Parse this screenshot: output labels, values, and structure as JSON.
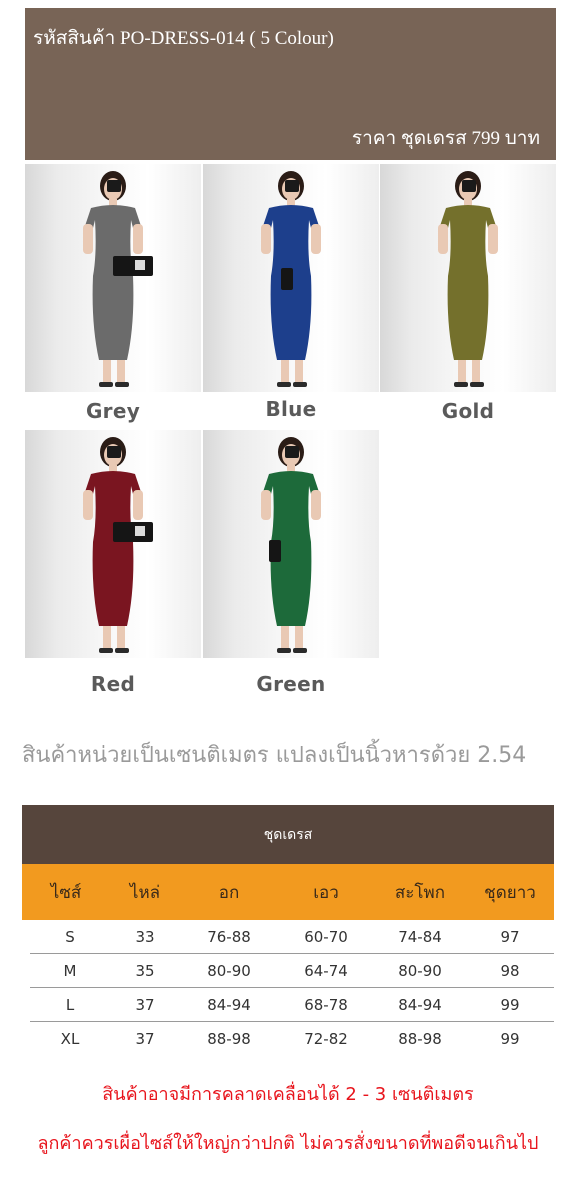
{
  "header": {
    "product_code": "รหัสสินค้า PO-DRESS-014 ( 5 Colour)",
    "price": "ราคา ชุดเดรส 799 บาท"
  },
  "colors": [
    {
      "name": "Grey",
      "dress_color": "#6b6b6b"
    },
    {
      "name": "Blue",
      "dress_color": "#1d3f8c"
    },
    {
      "name": "Gold",
      "dress_color": "#74702c"
    },
    {
      "name": "Red",
      "dress_color": "#7a1520"
    },
    {
      "name": "Green",
      "dress_color": "#1d6a3a"
    }
  ],
  "unit_note": "สินค้าหน่วยเป็นเซนติเมตร แปลงเป็นนิ้วหารด้วย 2.54",
  "size_table": {
    "title": "ชุดเดรส",
    "headers": [
      "ไซส์",
      "ไหล่",
      "อก",
      "เอว",
      "สะโพก",
      "ชุดยาว"
    ],
    "rows": [
      [
        "S",
        "33",
        "76-88",
        "60-70",
        "74-84",
        "97"
      ],
      [
        "M",
        "35",
        "80-90",
        "64-74",
        "80-90",
        "98"
      ],
      [
        "L",
        "37",
        "84-94",
        "68-78",
        "84-94",
        "99"
      ],
      [
        "XL",
        "37",
        "88-98",
        "72-82",
        "88-98",
        "99"
      ]
    ]
  },
  "warnings": [
    "สินค้าอาจมีการคลาดเคลื่อนได้ 2 - 3 เซนติเมตร",
    "ลูกค้าควรเผื่อไซส์ให้ใหญ่กว่าปกติ ไม่ควรสั่งขนาดที่พอดีจนเกินไป"
  ],
  "theme": {
    "header_bg": "#786456",
    "table_title_bg": "#56453c",
    "table_header_bg": "#f29a1f",
    "warning_color": "#e8141c"
  }
}
